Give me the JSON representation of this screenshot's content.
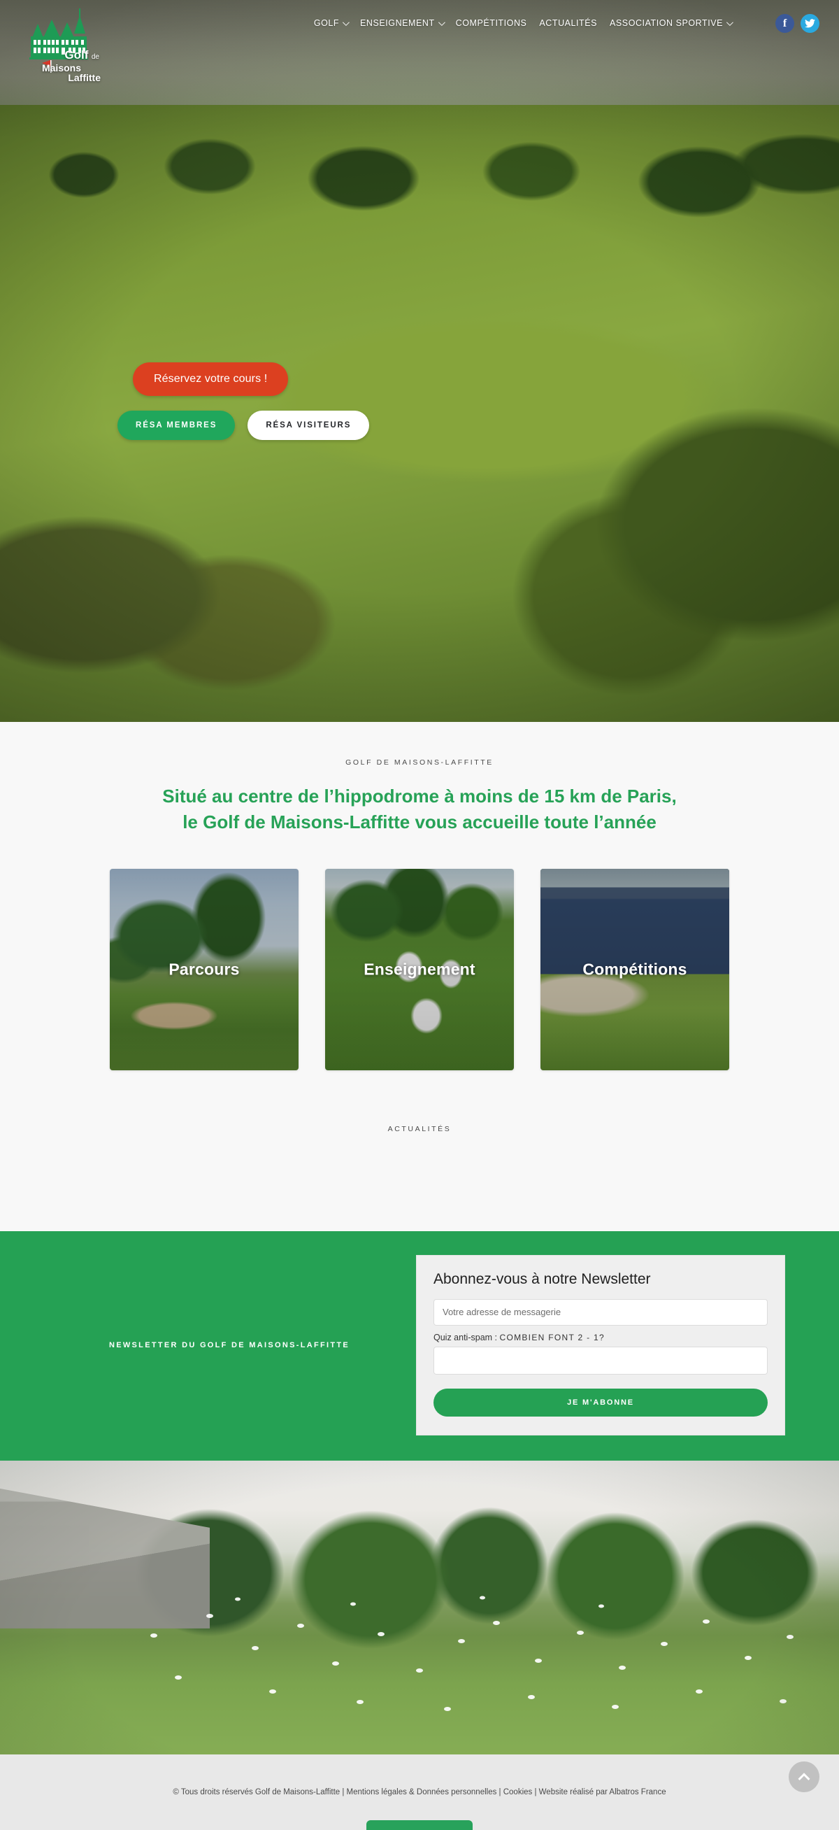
{
  "brand": {
    "name_line1": "Golf",
    "name_de": "de",
    "name_line2": "Maisons",
    "name_line3": "Laffitte",
    "accent_green": "#25a154",
    "accent_red": "#dc4020"
  },
  "nav": {
    "items": [
      {
        "label": "GOLF",
        "has_dropdown": true
      },
      {
        "label": "ENSEIGNEMENT",
        "has_dropdown": true
      },
      {
        "label": "COMPÉTITIONS",
        "has_dropdown": false
      },
      {
        "label": "ACTUALITÉS",
        "has_dropdown": false
      },
      {
        "label": "ASSOCIATION SPORTIVE",
        "has_dropdown": true
      }
    ],
    "social": [
      {
        "name": "facebook-icon",
        "glyph": "f"
      },
      {
        "name": "twitter-icon",
        "glyph": "🐦"
      }
    ]
  },
  "hero": {
    "cta_primary": "Réservez votre cours !",
    "cta_members": "RÉSA MEMBRES",
    "cta_visitors": "RÉSA VISITEURS"
  },
  "intro": {
    "eyebrow": "GOLF DE MAISONS-LAFFITTE",
    "title_line1": "Situé au centre de l’hippodrome à moins de 15 km de Paris,",
    "title_line2": "le Golf de Maisons-Laffitte vous accueille toute l’année"
  },
  "cards": [
    {
      "label": "Parcours"
    },
    {
      "label": "Enseignement"
    },
    {
      "label": "Compétitions"
    }
  ],
  "news": {
    "eyebrow": "ACTUALITÉS"
  },
  "newsletter": {
    "side_label": "NEWSLETTER DU GOLF DE MAISONS-LAFFITTE",
    "title": "Abonnez-vous à notre Newsletter",
    "email_placeholder": "Votre adresse de messagerie",
    "email_value": "",
    "quiz_prefix": "Quiz anti-spam : ",
    "quiz_question": "COMBIEN FONT 2 - 1?",
    "answer_value": "",
    "submit_label": "JE M'ABONNE"
  },
  "footer": {
    "copyright": "© Tous droits réservés Golf de Maisons-Laffitte | Mentions légales & Données personnelles | Cookies | Website réalisé par Albatros France",
    "to_top_icon": "chevron-up-icon"
  }
}
